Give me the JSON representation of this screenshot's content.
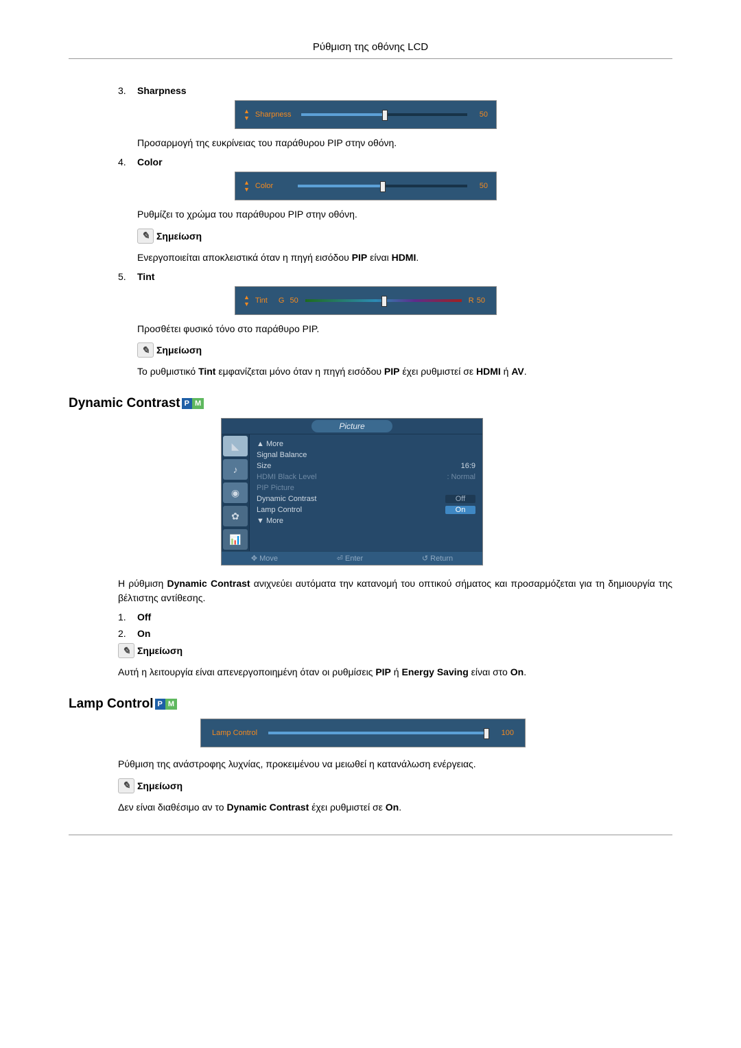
{
  "page_header": "Ρύθμιση της οθόνης LCD",
  "items": {
    "sharpness": {
      "num": "3.",
      "title": "Sharpness",
      "osd_label": "Sharpness",
      "osd_value": "50",
      "desc": "Προσαρμογή της ευκρίνειας του παράθυρου PIP στην οθόνη."
    },
    "color": {
      "num": "4.",
      "title": "Color",
      "osd_label": "Color",
      "osd_value": "50",
      "desc": "Ρυθμίζει το χρώμα του παράθυρου PIP στην οθόνη.",
      "note_label": "Σημείωση",
      "note_text": "Ενεργοποιείται αποκλειστικά όταν η πηγή εισόδου PIP είναι HDMI."
    },
    "tint": {
      "num": "5.",
      "title": "Tint",
      "osd_label": "Tint",
      "g": "G",
      "g_val": "50",
      "r": "R",
      "r_val": "50",
      "desc": "Προσθέτει φυσικό τόνο στο παράθυρο PIP.",
      "note_label": "Σημείωση",
      "note_text": "Το ρυθμιστικό Tint εμφανίζεται μόνο όταν η πηγή εισόδου PIP έχει ρυθμιστεί σε HDMI ή AV."
    },
    "dynamic_contrast": {
      "title": "Dynamic Contrast",
      "menu": {
        "title": "Picture",
        "more_up": "▲ More",
        "rows": [
          {
            "k": "Signal Balance",
            "v": ""
          },
          {
            "k": "Size",
            "v": "16:9"
          },
          {
            "k": "HDMI Black Level",
            "v": ": Normal",
            "dim": true
          },
          {
            "k": "PIP Picture",
            "v": "",
            "dim": true
          },
          {
            "k": "Dynamic Contrast",
            "v": "Off",
            "badge": "off"
          },
          {
            "k": "Lamp Control",
            "v": "On",
            "badge": "on"
          }
        ],
        "more_down": "▼ More",
        "footer": {
          "move": "Move",
          "enter": "Enter",
          "return": "Return"
        }
      },
      "desc": "Η ρύθμιση Dynamic Contrast ανιχνεύει αυτόματα την κατανομή του οπτικού σήματος και προσαρμόζεται για τη δημιουργία της βέλτιστης αντίθεσης.",
      "opt1_num": "1.",
      "opt1": "Off",
      "opt2_num": "2.",
      "opt2": "On",
      "note_label": "Σημείωση",
      "note_text": "Αυτή η λειτουργία είναι απενεργοποιημένη όταν οι ρυθμίσεις PIP ή Energy Saving είναι στο On."
    },
    "lamp_control": {
      "title": "Lamp Control",
      "osd_label": "Lamp Control",
      "osd_value": "100",
      "desc": "Ρύθμιση της ανάστροφης λυχνίας, προκειμένου να μειωθεί η κατανάλωση ενέργειας.",
      "note_label": "Σημείωση",
      "note_text": "Δεν είναι διαθέσιμο αν το Dynamic Contrast έχει ρυθμιστεί σε On."
    }
  },
  "note_icon_glyph": "✎"
}
